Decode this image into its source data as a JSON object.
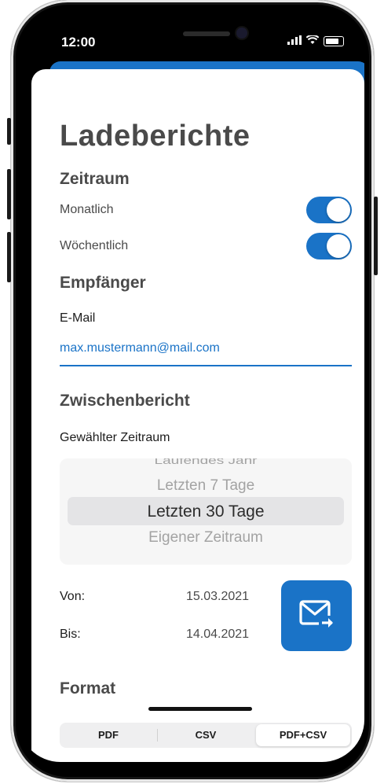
{
  "status": {
    "time": "12:00"
  },
  "page": {
    "title": "Ladeberichte"
  },
  "period": {
    "heading": "Zeitraum",
    "monthly_label": "Monatlich",
    "monthly_on": true,
    "weekly_label": "Wöchentlich",
    "weekly_on": true
  },
  "recipient": {
    "heading": "Empfänger",
    "email_label": "E-Mail",
    "email_value": "max.mustermann@mail.com"
  },
  "interim": {
    "heading": "Zwischenbericht",
    "period_label": "Gewählter Zeitraum",
    "picker_options": [
      "Laufendes Jahr",
      "Letzten 7 Tage",
      "Letzten 30 Tage",
      "Eigener Zeitraum"
    ],
    "picker_selected": "Letzten 30 Tage",
    "from_label": "Von:",
    "from_value": "15.03.2021",
    "to_label": "Bis:",
    "to_value": "14.04.2021",
    "send_icon": "mail-send-icon"
  },
  "format": {
    "heading": "Format",
    "options": [
      "PDF",
      "CSV",
      "PDF+CSV"
    ],
    "selected": "PDF+CSV"
  },
  "colors": {
    "accent": "#1a73c7",
    "text": "#4a4a4a"
  }
}
